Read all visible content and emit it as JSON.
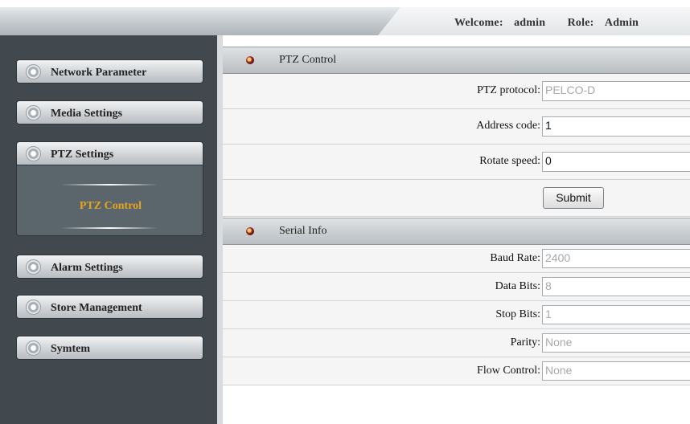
{
  "header": {
    "welcome_label": "Welcome:",
    "username": "admin",
    "role_label": "Role:",
    "role": "Admin"
  },
  "sidebar": {
    "items": [
      {
        "label": "Network Parameter"
      },
      {
        "label": "Media Settings"
      },
      {
        "label": "PTZ Settings"
      },
      {
        "label": "Alarm Settings"
      },
      {
        "label": "Store Management"
      },
      {
        "label": "Symtem"
      }
    ],
    "submenu": {
      "items": [
        {
          "label": "PTZ Control"
        }
      ]
    }
  },
  "ptz_control": {
    "title": "PTZ Control",
    "fields": [
      {
        "label": "PTZ protocol:",
        "value": "PELCO-D"
      },
      {
        "label": "Address code:",
        "value": "1"
      },
      {
        "label": "Rotate speed:",
        "value": "0"
      }
    ],
    "submit_label": "Submit"
  },
  "serial_info": {
    "title": "Serial Info",
    "fields": [
      {
        "label": "Baud Rate:",
        "value": "2400"
      },
      {
        "label": "Data Bits:",
        "value": "8"
      },
      {
        "label": "Stop Bits:",
        "value": "1"
      },
      {
        "label": "Parity:",
        "value": "None"
      },
      {
        "label": "Flow Control:",
        "value": "None"
      }
    ]
  }
}
